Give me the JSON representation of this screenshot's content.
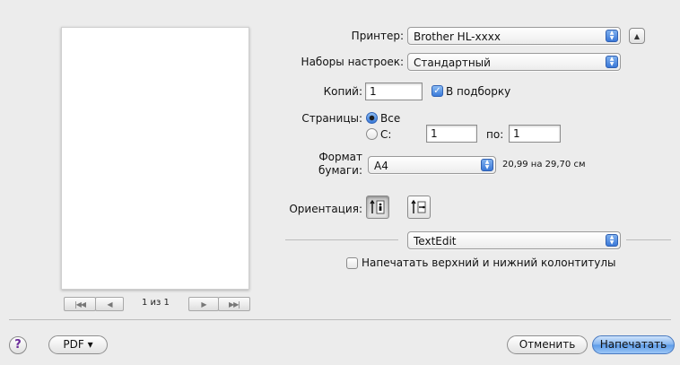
{
  "preview": {
    "page_counter": "1 из 1",
    "first_icon": "|◀◀",
    "prev_icon": "◀",
    "next_icon": "▶",
    "last_icon": "▶▶|"
  },
  "printer": {
    "label": "Принтер:",
    "value": "Brother HL-xxxx"
  },
  "presets": {
    "label": "Наборы настроек:",
    "value": "Стандартный"
  },
  "copies": {
    "label": "Копий:",
    "value": "1",
    "collate_label": "В подборку",
    "collate_checked": true
  },
  "pages": {
    "label": "Страницы:",
    "all_label": "Все",
    "range_label": "С:",
    "from_value": "1",
    "to_label": "по:",
    "to_value": "1",
    "selected": "all"
  },
  "paper": {
    "label_line1": "Формат",
    "label_line2": "бумаги:",
    "value": "A4",
    "size_text": "20,99 на 29,70 см"
  },
  "orientation": {
    "label": "Ориентация:",
    "selected": "portrait"
  },
  "app_section": {
    "value": "TextEdit"
  },
  "header_footer": {
    "label": "Напечатать верхний и нижний колонтитулы",
    "checked": false
  },
  "footer": {
    "help_label": "?",
    "pdf_label": "PDF ▾",
    "cancel_label": "Отменить",
    "print_label": "Напечатать"
  },
  "colors": {
    "accent": "#3a78d8",
    "background": "#ececec",
    "help_icon": "#6a2c9a"
  }
}
